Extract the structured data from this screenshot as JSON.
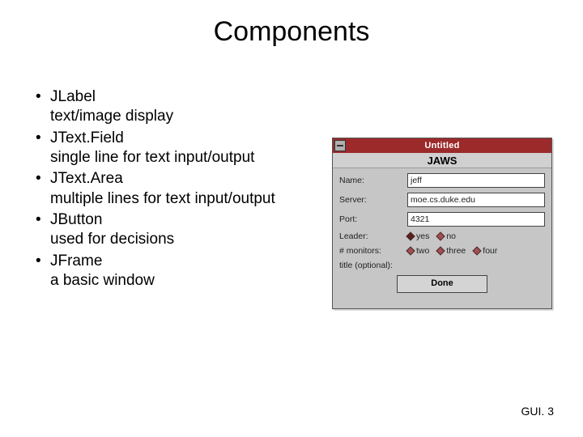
{
  "title": "Components",
  "bullets": [
    {
      "name": "JLabel",
      "desc": "text/image display"
    },
    {
      "name": "JText.Field",
      "desc": "single line for text input/output"
    },
    {
      "name": "JText.Area",
      "desc": "multiple lines for text input/output"
    },
    {
      "name": "JButton",
      "desc": "used for decisions"
    },
    {
      "name": "JFrame",
      "desc": "a basic window"
    }
  ],
  "mock_window": {
    "titlebar": "Untitled",
    "heading": "JAWS",
    "fields": {
      "name_label": "Name:",
      "name_value": "jeff",
      "server_label": "Server:",
      "server_value": "moe.cs.duke.edu",
      "port_label": "Port:",
      "port_value": "4321",
      "leader_label": "Leader:",
      "leader_options": [
        "yes",
        "no"
      ],
      "monitors_label": "# monitors:",
      "monitors_options": [
        "two",
        "three",
        "four"
      ],
      "filler_label": "title (optional):"
    },
    "button": "Done"
  },
  "footer": "GUI. 3"
}
